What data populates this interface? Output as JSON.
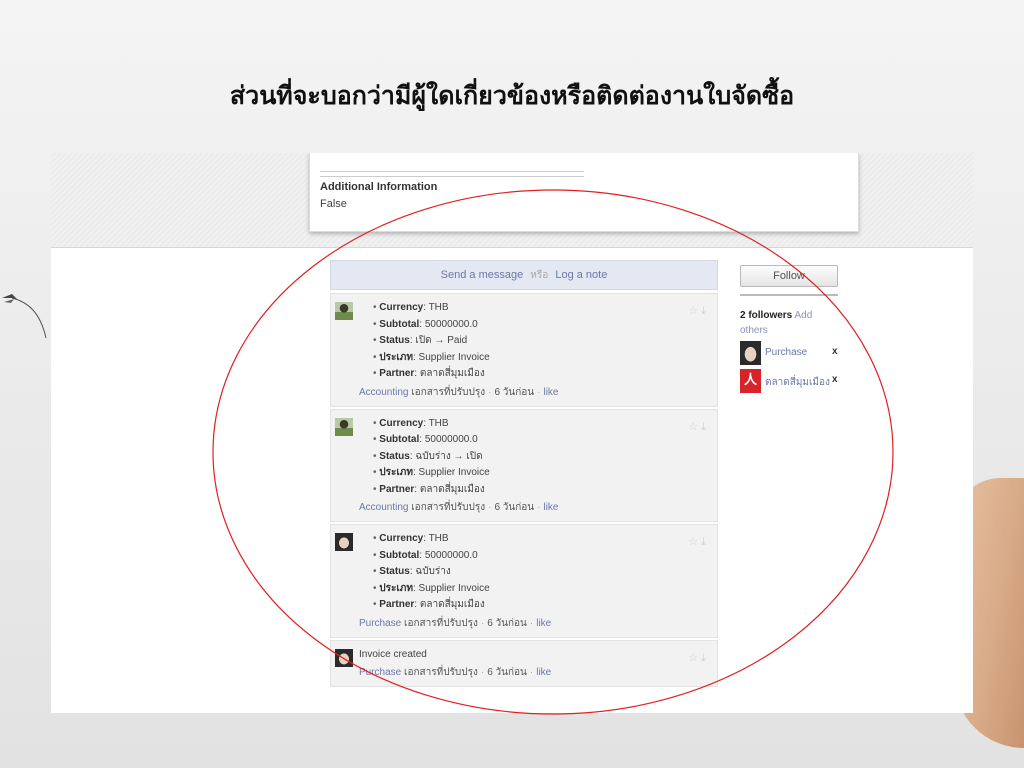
{
  "slide": {
    "title": "ส่วนที่จะบอกว่ามีผู้ใดเกี่ยวข้องหรือติดต่องานใบจัดซื้อ"
  },
  "info_card": {
    "label": "Additional Information",
    "value": "False"
  },
  "composer": {
    "send_label": "Send a message",
    "or_label": "หรือ",
    "log_label": "Log a note"
  },
  "messages": [
    {
      "fields": [
        {
          "label": "Currency",
          "value": ": THB"
        },
        {
          "label": "Subtotal",
          "value": ": 50000000.0"
        },
        {
          "label": "Status",
          "value": ": เปิด → Paid"
        },
        {
          "label": "ประเภท",
          "value": ": Supplier Invoice"
        },
        {
          "label": "Partner",
          "value": ": ตลาดสี่มุมเมือง"
        }
      ],
      "meta": {
        "link": "Accounting",
        "text": "เอกสารที่ปรับปรุง",
        "time": "6 วันก่อน",
        "like": "like"
      }
    },
    {
      "fields": [
        {
          "label": "Currency",
          "value": ": THB"
        },
        {
          "label": "Subtotal",
          "value": ": 50000000.0"
        },
        {
          "label": "Status",
          "value": ": ฉบับร่าง → เปิด"
        },
        {
          "label": "ประเภท",
          "value": ": Supplier Invoice"
        },
        {
          "label": "Partner",
          "value": ": ตลาดสี่มุมเมือง"
        }
      ],
      "meta": {
        "link": "Accounting",
        "text": "เอกสารที่ปรับปรุง",
        "time": "6 วันก่อน",
        "like": "like"
      }
    },
    {
      "fields": [
        {
          "label": "Currency",
          "value": ": THB"
        },
        {
          "label": "Subtotal",
          "value": ": 50000000.0"
        },
        {
          "label": "Status",
          "value": ": ฉบับร่าง"
        },
        {
          "label": "ประเภท",
          "value": ": Supplier Invoice"
        },
        {
          "label": "Partner",
          "value": ": ตลาดสี่มุมเมือง"
        }
      ],
      "meta": {
        "link": "Purchase",
        "text": "เอกสารที่ปรับปรุง",
        "time": "6 วันก่อน",
        "like": "like"
      }
    },
    {
      "text": "Invoice created",
      "meta": {
        "link": "Purchase",
        "text": "เอกสารที่ปรับปรุง",
        "time": "6 วันก่อน",
        "like": "like"
      }
    }
  ],
  "sidebar": {
    "follow_label": "Follow",
    "followers_count": "2 followers",
    "add_label": "Add",
    "others_label": "others",
    "followers": [
      {
        "name": "Purchase",
        "remove": "x"
      },
      {
        "name": "ตลาดสี่มุมเมือง",
        "remove": "x"
      }
    ]
  },
  "colors": {
    "accent_link": "#6b78a8",
    "annotation": "#e02020"
  }
}
